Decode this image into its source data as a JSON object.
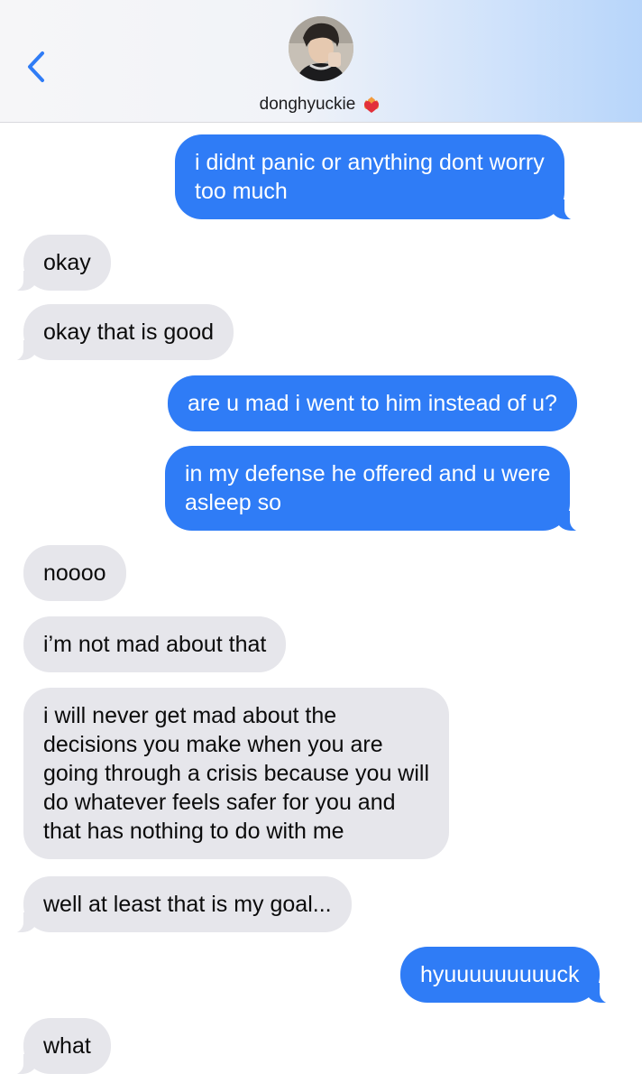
{
  "header": {
    "contact_name": "donghyuckie",
    "back_icon": "chevron-left-icon",
    "name_emoji_icon": "heart-on-fire-icon",
    "accent_color": "#2f7cf6"
  },
  "messages": [
    {
      "sender": "me",
      "text_lines": [
        "i didnt panic or anything dont worry",
        "too much"
      ]
    },
    {
      "sender": "contact",
      "text_lines": [
        "okay"
      ]
    },
    {
      "sender": "contact",
      "text_lines": [
        "okay that is good"
      ]
    },
    {
      "sender": "me",
      "text_lines": [
        "are u mad i went to him instead of u?"
      ]
    },
    {
      "sender": "me",
      "text_lines": [
        "in my defense he offered and u were",
        "asleep so"
      ]
    },
    {
      "sender": "contact",
      "text_lines": [
        "noooo"
      ]
    },
    {
      "sender": "contact",
      "text_lines": [
        "i’m not mad about that"
      ]
    },
    {
      "sender": "contact",
      "text_lines": [
        "i will never get mad about the",
        "decisions you make when you are",
        "going through a crisis because you will",
        "do whatever feels safer for you and",
        "that has nothing to do with me"
      ]
    },
    {
      "sender": "contact",
      "text_lines": [
        "well at least that is my goal..."
      ]
    },
    {
      "sender": "me",
      "text_lines": [
        "hyuuuuuuuuuck"
      ]
    },
    {
      "sender": "contact",
      "text_lines": [
        "what"
      ]
    }
  ]
}
